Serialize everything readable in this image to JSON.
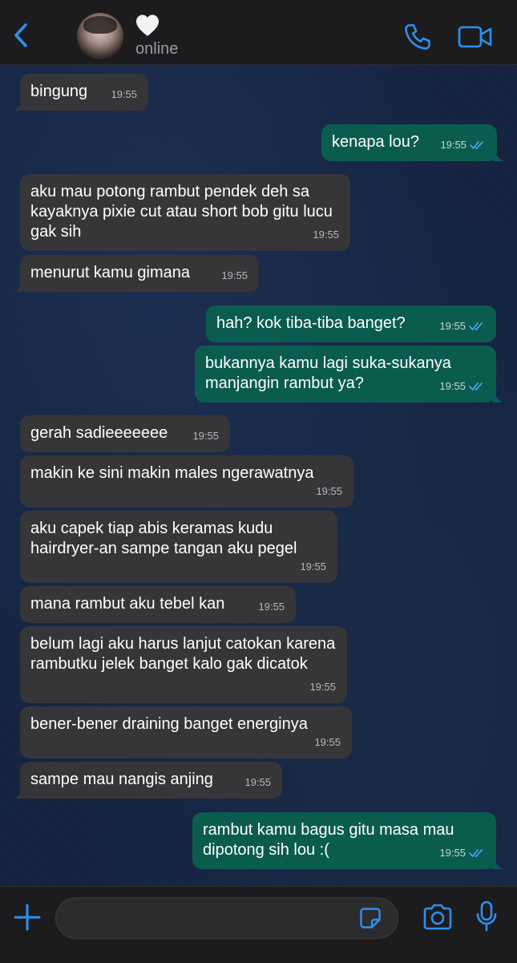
{
  "header": {
    "contact_name": "🤍",
    "status": "online",
    "icons": {
      "back": "chevron-left-icon",
      "call": "phone-icon",
      "video": "video-camera-icon"
    }
  },
  "messages": [
    {
      "side": "in",
      "text": "bingung",
      "time": "19:55"
    },
    {
      "side": "out",
      "text": "kenapa lou?",
      "time": "19:55",
      "read": true
    },
    {
      "side": "in",
      "text": "aku mau potong rambut pendek deh sa kayaknya pixie cut atau short bob gitu lucu gak sih",
      "time": "19:55"
    },
    {
      "side": "in",
      "text": "menurut kamu gimana",
      "time": "19:55"
    },
    {
      "side": "out",
      "text": "hah? kok tiba-tiba banget?",
      "time": "19:55",
      "read": true
    },
    {
      "side": "out",
      "text": "bukannya kamu lagi suka-sukanya manjangin rambut ya?",
      "time": "19:55",
      "read": true
    },
    {
      "side": "in",
      "text": "gerah sadieeeeeee",
      "time": "19:55"
    },
    {
      "side": "in",
      "text": "makin ke sini makin males ngerawatnya",
      "time": "19:55"
    },
    {
      "side": "in",
      "text": "aku capek tiap abis keramas kudu hairdryer-an sampe tangan aku pegel",
      "time": "19:55"
    },
    {
      "side": "in",
      "text": "mana rambut aku tebel kan",
      "time": "19:55"
    },
    {
      "side": "in",
      "text": "belum lagi aku harus lanjut catokan karena rambutku jelek banget kalo gak dicatok",
      "time": "19:55"
    },
    {
      "side": "in",
      "text": "bener-bener draining banget energinya",
      "time": "19:55"
    },
    {
      "side": "in",
      "text": "sampe mau nangis anjing",
      "time": "19:55"
    },
    {
      "side": "out",
      "text": "rambut kamu bagus gitu masa mau dipotong sih lou :(",
      "time": "19:55",
      "read": true
    }
  ],
  "input": {
    "value": "",
    "icons": {
      "attach": "plus-icon",
      "sticker": "sticker-icon",
      "camera": "camera-icon",
      "mic": "microphone-icon"
    }
  },
  "colors": {
    "accent": "#2f8ff0",
    "incoming_bubble": "#363638",
    "outgoing_bubble": "#0a5c4f",
    "read_ticks": "#53a6ff"
  }
}
